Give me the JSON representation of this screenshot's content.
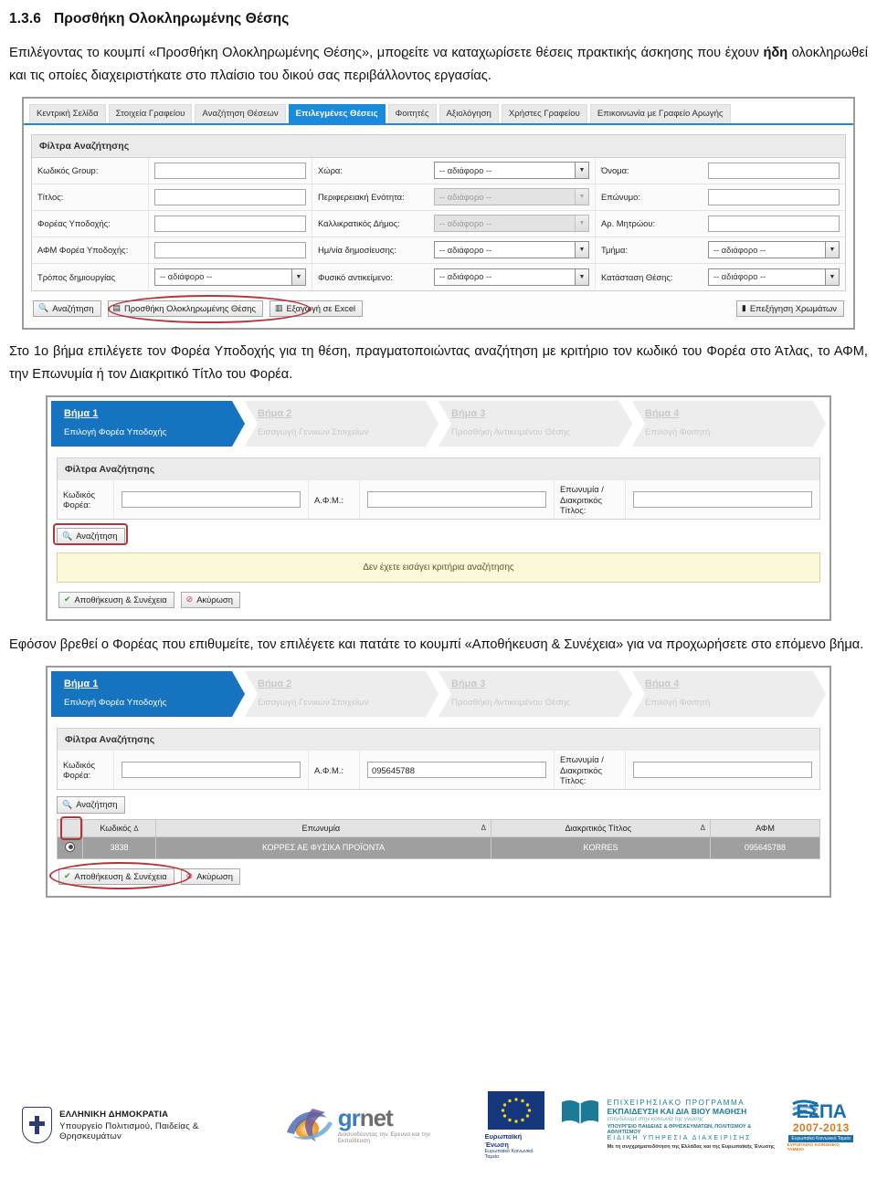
{
  "heading": {
    "number": "1.3.6",
    "title": "Προσθήκη Ολοκληρωμένης Θέσης"
  },
  "paragraphs": {
    "p1_a": "Επιλέγοντας το κουμπί «Προσθήκη Ολοκληρωμένης Θέσης», μποϱείτε να καταχωρίσετε θέσεις πρακτικής άσκησης που έχουν ",
    "p1_bold": "ήδη",
    "p1_b": " ολοκληρωθεί και τις οποίες διαχειριστήκατε στο πλαίσιο του δικού σας περιβάλλοντος εργασίας.",
    "p2": "Στο 1ο βήμα επιλέγετε τον Φορέα Υποδοχής για τη θέση, πραγματοποιώντας αναζήτηση με κριτήριο τον κωδικό του Φορέα στο Άτλας, το ΑΦΜ, την Επωνυμία ή τον Διακριτικό Τίτλο του Φορέα.",
    "p3": "Εφόσον βρεθεί ο Φορέας που επιθυμείτε, τον επιλέγετε και πατάτε το κουμπί  «Αποθήκευση & Συνέχεια» για να προχωρήσετε στο επόμενο βήμα."
  },
  "screenshot1": {
    "tabs": [
      {
        "label": "Κεντρική Σελίδα",
        "active": false
      },
      {
        "label": "Στοιχεία Γραφείου",
        "active": false
      },
      {
        "label": "Αναζήτηση Θέσεων",
        "active": false
      },
      {
        "label": "Επιλεγμένες Θέσεις",
        "active": true
      },
      {
        "label": "Φοιτητές",
        "active": false
      },
      {
        "label": "Αξιολόγηση",
        "active": false
      },
      {
        "label": "Χρήστες Γραφείου",
        "active": false
      },
      {
        "label": "Επικοινωνία με Γραφείο Αρωγής",
        "active": false
      }
    ],
    "fieldset_title": "Φίλτρα Αναζήτησης",
    "rows": [
      {
        "l1": "Κωδικός Group:",
        "f1_type": "text",
        "f1_value": "",
        "l2": "Χώρα:",
        "f2_type": "select",
        "f2_value": "-- αδιάφορο --",
        "f2_disabled": false,
        "l3": "Όνομα:",
        "f3_type": "text",
        "f3_value": ""
      },
      {
        "l1": "Τίτλος:",
        "f1_type": "text",
        "f1_value": "",
        "l2": "Περιφερειακή Ενότητα:",
        "f2_type": "select",
        "f2_value": "-- αδιάφορο --",
        "f2_disabled": true,
        "l3": "Επώνυμο:",
        "f3_type": "text",
        "f3_value": ""
      },
      {
        "l1": "Φορέας Υποδοχής:",
        "f1_type": "text",
        "f1_value": "",
        "l2": "Καλλικρατικός Δήμος:",
        "f2_type": "select",
        "f2_value": "-- αδιάφορο --",
        "f2_disabled": true,
        "l3": "Αρ. Μητρώου:",
        "f3_type": "text",
        "f3_value": ""
      },
      {
        "l1": "ΑΦΜ Φορέα Υποδοχής:",
        "f1_type": "text",
        "f1_value": "",
        "l2": "Ημ/νία δημοσίευσης:",
        "f2_type": "select",
        "f2_value": "-- αδιάφορο --",
        "f2_disabled": false,
        "l3": "Τμήμα:",
        "f3_type": "select",
        "f3_value": "-- αδιάφορο --"
      },
      {
        "l1": "Τρόπος δημιουργίας",
        "f1_type": "select",
        "f1_value": "-- αδιάφορο --",
        "l2": "Φυσικό αντικείμενο:",
        "f2_type": "select",
        "f2_value": "-- αδιάφορο --",
        "f2_disabled": false,
        "l3": "Κατάσταση Θέσης:",
        "f3_type": "select",
        "f3_value": "-- αδιάφορο --"
      }
    ],
    "buttons": {
      "search": "Αναζήτηση",
      "add_completed": "Προσθήκη Ολοκληρωμένης Θέσης",
      "export_excel": "Εξαγωγή σε Excel",
      "color_legend": "Επεξήγηση Χρωμάτων"
    }
  },
  "wizard": {
    "steps": [
      {
        "title": "Βήμα 1",
        "subtitle": "Επιλογή Φορέα Υποδοχής",
        "active": true
      },
      {
        "title": "Βήμα 2",
        "subtitle": "Εισαγωγή Γενικών Στοιχείων",
        "active": false
      },
      {
        "title": "Βήμα 3",
        "subtitle": "Προσθήκη Αντικειμένου Θέσης",
        "active": false
      },
      {
        "title": "Βήμα 4",
        "subtitle": "Επιλογή Φοιτητή",
        "active": false
      }
    ]
  },
  "screenshot2": {
    "fieldset_title": "Φίλτρα Αναζήτησης",
    "labels": {
      "code": "Κωδικός Φορέα:",
      "afm": "Α.Φ.Μ.:",
      "name": "Επωνυμία / Διακριτικός Τίτλος:"
    },
    "values": {
      "code": "",
      "afm": "",
      "name": ""
    },
    "search_button": "Αναζήτηση",
    "message": "Δεν έχετε εισάγει κριτήρια αναζήτησης",
    "save_button": "Αποθήκευση & Συνέχεια",
    "cancel_button": "Ακύρωση"
  },
  "screenshot3": {
    "fieldset_title": "Φίλτρα Αναζήτησης",
    "labels": {
      "code": "Κωδικός Φορέα:",
      "afm": "Α.Φ.Μ.:",
      "name": "Επωνυμία / Διακριτικός Τίτλος:"
    },
    "values": {
      "code": "",
      "afm": "095645788",
      "name": ""
    },
    "search_button": "Αναζήτηση",
    "table": {
      "headers": [
        "",
        "Κωδικός",
        "Επωνυμία",
        "Διακριτικός Τίτλος",
        "ΑΦΜ"
      ],
      "sort_glyph": "Δ",
      "rows": [
        {
          "code": "3838",
          "name": "ΚΟΡΡΕΣ ΑΕ ΦΥΣΙΚΑ ΠΡΟΪΟΝΤΑ",
          "title": "KORRES",
          "afm": "095645788"
        }
      ]
    },
    "save_button": "Αποθήκευση & Συνέχεια",
    "cancel_button": "Ακύρωση"
  },
  "footer": {
    "republic_line1": "ΕΛΛΗΝΙΚΗ ΔΗΜΟΚΡΑΤΙΑ",
    "republic_line2": "Υπουργείο Πολιτισμού, Παιδείας & Θρησκευμάτων",
    "grnet_gr": "gr",
    "grnet_net": "net",
    "grnet_tagline": "Διασυνδέοντας την Έρευνα και την Εκπαίδευση",
    "eu_line1": "Ευρωπαϊκή Ένωση",
    "eu_line2": "Ευρωπαϊκό Κοινωνικό Ταμείο",
    "espa_p1": "ΕΠΙΧΕΙΡΗΣΙΑΚΟ  ΠΡΟΓΡΑΜΜΑ",
    "espa_p2": "ΕΚΠΑΙΔΕΥΣΗ ΚΑΙ ΔΙΑ ΒΙΟΥ ΜΑΘΗΣΗ",
    "espa_p3": "επενδύουμε στην κοινωνία της γνώσης",
    "espa_p4": "ΥΠΟΥΡΓΕΙΟ ΠΑΙΔΕΙΑΣ & ΘΡΗΣΚΕΥΜΑΤΩΝ, ΠΟΛΙΤΙΣΜΟΥ & ΑΘΛΗΤΙΣΜΟΥ",
    "espa_p5": "ΕΙΔΙΚΗ  ΥΠΗΡΕΣΙΑ  ΔΙΑΧΕΙΡΙΣΗΣ",
    "espa_p6": "Με τη συγχρηματοδότηση της Ελλάδας και της Ευρωπαϊκής Ένωσης",
    "espa_word": "ΕΣΠΑ",
    "espa_years": "2007-2013",
    "espa_bar": "Ευρωπαϊκό Κοινωνικό Ταμείο",
    "espa_sub": "ΕΥΡΩΠΑΪΚΟ ΚΟΙΝΩΝΙΚΟ ΤΑΜΕΙΟ"
  },
  "colors": {
    "accent_blue": "#1a8bd8",
    "step_blue": "#1573c0",
    "highlight_red": "#b4343a",
    "message_yellow": "#fbf8d8"
  }
}
